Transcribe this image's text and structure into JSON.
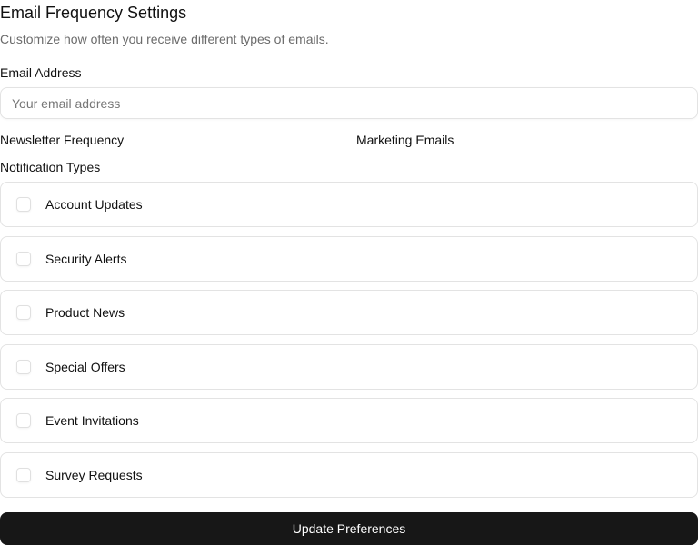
{
  "header": {
    "title": "Email Frequency Settings",
    "subtitle": "Customize how often you receive different types of emails."
  },
  "email": {
    "label": "Email Address",
    "placeholder": "Your email address",
    "value": ""
  },
  "newsletter": {
    "label": "Newsletter Frequency"
  },
  "marketing": {
    "label": "Marketing Emails"
  },
  "notifications": {
    "label": "Notification Types",
    "items": [
      {
        "label": "Account Updates",
        "checked": false
      },
      {
        "label": "Security Alerts",
        "checked": false
      },
      {
        "label": "Product News",
        "checked": false
      },
      {
        "label": "Special Offers",
        "checked": false
      },
      {
        "label": "Event Invitations",
        "checked": false
      },
      {
        "label": "Survey Requests",
        "checked": false
      }
    ]
  },
  "submit": {
    "label": "Update Preferences"
  }
}
